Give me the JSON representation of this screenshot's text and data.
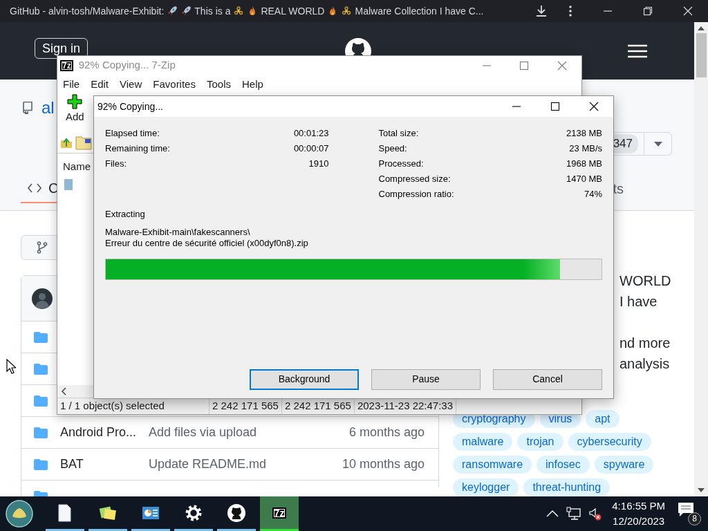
{
  "browser": {
    "title_parts": [
      "GitHub - alvin-tosh/Malware-Exhibit:",
      "This is a",
      "REAL WORLD",
      "Malware Collection I have C..."
    ]
  },
  "github": {
    "sign_in": "Sign in",
    "repo_name": "al",
    "code_tab": {
      "label": "C",
      "selected": true
    },
    "insights_tab": "ts",
    "star_count": "347",
    "about": [
      [
        "WORLD",
        "I have"
      ],
      [
        "nd more",
        "analysis"
      ]
    ],
    "topics": [
      "cryptography",
      "virus",
      "apt",
      "malware",
      "trojan",
      "cybersecurity",
      "ransomware",
      "infosec",
      "spyware",
      "keylogger",
      "threat-hunting"
    ],
    "files": [
      {
        "kind": "folder"
      },
      {
        "kind": "folder"
      },
      {
        "kind": "folder"
      },
      {
        "kind": "folder",
        "name": "Android Pro...",
        "message": "Add files via upload",
        "time": "6 months ago"
      },
      {
        "kind": "folder",
        "name": "BAT",
        "message": "Update README.md",
        "time": "10 months ago"
      },
      {
        "kind": "folder"
      }
    ]
  },
  "seven_zip": {
    "logo": "7z",
    "title": "92% Copying... 7-Zip",
    "menu": [
      "File",
      "Edit",
      "View",
      "Favorites",
      "Tools",
      "Help"
    ],
    "toolbar": [
      "Add"
    ],
    "list_header": "Name",
    "status": [
      "1 / 1 object(s) selected",
      "2 242 171 565",
      "2 242 171 565",
      "2023-11-23 22:47:33"
    ]
  },
  "progress": {
    "title": "92% Copying...",
    "left_stats": [
      {
        "label": "Elapsed time:",
        "value": "00:01:23"
      },
      {
        "label": "Remaining time:",
        "value": "00:00:07"
      },
      {
        "label": "Files:",
        "value": "1910"
      }
    ],
    "right_stats": [
      {
        "label": "Total size:",
        "value": "2138 MB"
      },
      {
        "label": "Speed:",
        "value": "23 MB/s"
      },
      {
        "label": "Processed:",
        "value": "1968 MB"
      },
      {
        "label": "Compressed size:",
        "value": "1470 MB"
      },
      {
        "label": "Compression ratio:",
        "value": "74%"
      }
    ],
    "operation": "Extracting",
    "path_lines": [
      "Malware-Exhibit-main\\fakescanners\\",
      "Erreur du centre de sécurité officiel (x00dyf0n8).zip"
    ],
    "level": 0.917,
    "buttons": [
      {
        "label": "Background",
        "focused": true
      },
      {
        "label": "Pause",
        "focused": false
      },
      {
        "label": "Cancel",
        "focused": false
      }
    ]
  },
  "taskbar": {
    "apps": [
      {
        "kind": "file",
        "running": true,
        "active": false
      },
      {
        "kind": "notes",
        "running": true,
        "active": false
      },
      {
        "kind": "chart",
        "running": true,
        "active": false
      },
      {
        "kind": "gear",
        "running": true,
        "active": false
      },
      {
        "kind": "cat",
        "running": true,
        "active": false
      },
      {
        "kind": "archive",
        "label": "7z",
        "running": true,
        "active": true
      }
    ],
    "time": "4:16:55 PM",
    "date": "12/20/2023",
    "notifications": "8"
  }
}
